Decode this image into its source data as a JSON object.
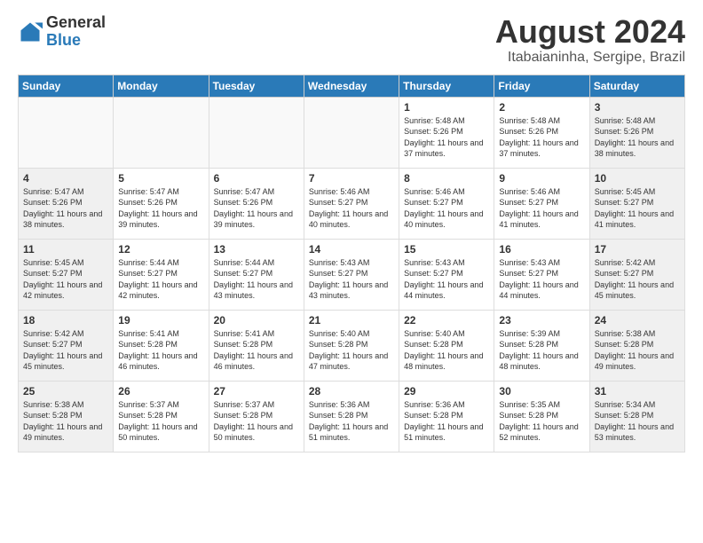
{
  "header": {
    "logo_general": "General",
    "logo_blue": "Blue",
    "month_title": "August 2024",
    "location": "Itabaianinha, Sergipe, Brazil"
  },
  "weekdays": [
    "Sunday",
    "Monday",
    "Tuesday",
    "Wednesday",
    "Thursday",
    "Friday",
    "Saturday"
  ],
  "weeks": [
    [
      {
        "day": "",
        "empty": true
      },
      {
        "day": "",
        "empty": true
      },
      {
        "day": "",
        "empty": true
      },
      {
        "day": "",
        "empty": true
      },
      {
        "day": "1",
        "sunrise": "5:48 AM",
        "sunset": "5:26 PM",
        "daylight": "11 hours and 37 minutes."
      },
      {
        "day": "2",
        "sunrise": "5:48 AM",
        "sunset": "5:26 PM",
        "daylight": "11 hours and 37 minutes."
      },
      {
        "day": "3",
        "sunrise": "5:48 AM",
        "sunset": "5:26 PM",
        "daylight": "11 hours and 38 minutes."
      }
    ],
    [
      {
        "day": "4",
        "sunrise": "5:47 AM",
        "sunset": "5:26 PM",
        "daylight": "11 hours and 38 minutes."
      },
      {
        "day": "5",
        "sunrise": "5:47 AM",
        "sunset": "5:26 PM",
        "daylight": "11 hours and 39 minutes."
      },
      {
        "day": "6",
        "sunrise": "5:47 AM",
        "sunset": "5:26 PM",
        "daylight": "11 hours and 39 minutes."
      },
      {
        "day": "7",
        "sunrise": "5:46 AM",
        "sunset": "5:27 PM",
        "daylight": "11 hours and 40 minutes."
      },
      {
        "day": "8",
        "sunrise": "5:46 AM",
        "sunset": "5:27 PM",
        "daylight": "11 hours and 40 minutes."
      },
      {
        "day": "9",
        "sunrise": "5:46 AM",
        "sunset": "5:27 PM",
        "daylight": "11 hours and 41 minutes."
      },
      {
        "day": "10",
        "sunrise": "5:45 AM",
        "sunset": "5:27 PM",
        "daylight": "11 hours and 41 minutes."
      }
    ],
    [
      {
        "day": "11",
        "sunrise": "5:45 AM",
        "sunset": "5:27 PM",
        "daylight": "11 hours and 42 minutes."
      },
      {
        "day": "12",
        "sunrise": "5:44 AM",
        "sunset": "5:27 PM",
        "daylight": "11 hours and 42 minutes."
      },
      {
        "day": "13",
        "sunrise": "5:44 AM",
        "sunset": "5:27 PM",
        "daylight": "11 hours and 43 minutes."
      },
      {
        "day": "14",
        "sunrise": "5:43 AM",
        "sunset": "5:27 PM",
        "daylight": "11 hours and 43 minutes."
      },
      {
        "day": "15",
        "sunrise": "5:43 AM",
        "sunset": "5:27 PM",
        "daylight": "11 hours and 44 minutes."
      },
      {
        "day": "16",
        "sunrise": "5:43 AM",
        "sunset": "5:27 PM",
        "daylight": "11 hours and 44 minutes."
      },
      {
        "day": "17",
        "sunrise": "5:42 AM",
        "sunset": "5:27 PM",
        "daylight": "11 hours and 45 minutes."
      }
    ],
    [
      {
        "day": "18",
        "sunrise": "5:42 AM",
        "sunset": "5:27 PM",
        "daylight": "11 hours and 45 minutes."
      },
      {
        "day": "19",
        "sunrise": "5:41 AM",
        "sunset": "5:28 PM",
        "daylight": "11 hours and 46 minutes."
      },
      {
        "day": "20",
        "sunrise": "5:41 AM",
        "sunset": "5:28 PM",
        "daylight": "11 hours and 46 minutes."
      },
      {
        "day": "21",
        "sunrise": "5:40 AM",
        "sunset": "5:28 PM",
        "daylight": "11 hours and 47 minutes."
      },
      {
        "day": "22",
        "sunrise": "5:40 AM",
        "sunset": "5:28 PM",
        "daylight": "11 hours and 48 minutes."
      },
      {
        "day": "23",
        "sunrise": "5:39 AM",
        "sunset": "5:28 PM",
        "daylight": "11 hours and 48 minutes."
      },
      {
        "day": "24",
        "sunrise": "5:38 AM",
        "sunset": "5:28 PM",
        "daylight": "11 hours and 49 minutes."
      }
    ],
    [
      {
        "day": "25",
        "sunrise": "5:38 AM",
        "sunset": "5:28 PM",
        "daylight": "11 hours and 49 minutes."
      },
      {
        "day": "26",
        "sunrise": "5:37 AM",
        "sunset": "5:28 PM",
        "daylight": "11 hours and 50 minutes."
      },
      {
        "day": "27",
        "sunrise": "5:37 AM",
        "sunset": "5:28 PM",
        "daylight": "11 hours and 50 minutes."
      },
      {
        "day": "28",
        "sunrise": "5:36 AM",
        "sunset": "5:28 PM",
        "daylight": "11 hours and 51 minutes."
      },
      {
        "day": "29",
        "sunrise": "5:36 AM",
        "sunset": "5:28 PM",
        "daylight": "11 hours and 51 minutes."
      },
      {
        "day": "30",
        "sunrise": "5:35 AM",
        "sunset": "5:28 PM",
        "daylight": "11 hours and 52 minutes."
      },
      {
        "day": "31",
        "sunrise": "5:34 AM",
        "sunset": "5:28 PM",
        "daylight": "11 hours and 53 minutes."
      }
    ]
  ]
}
